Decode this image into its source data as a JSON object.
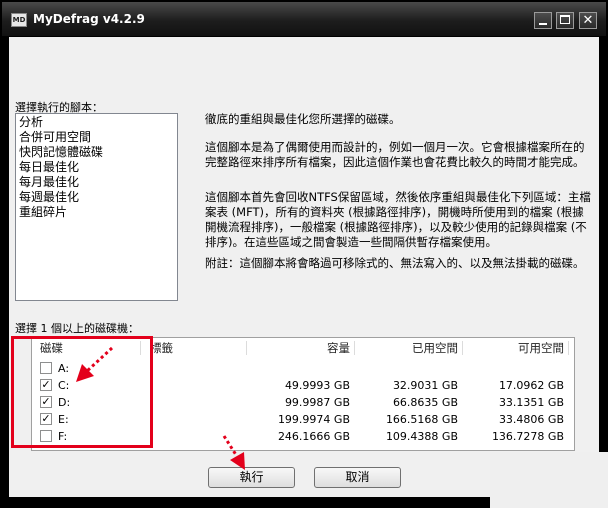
{
  "window": {
    "title": "MyDefrag v4.2.9",
    "icon_label": "MD",
    "close_glyph": "✕"
  },
  "script_section": {
    "label": "選擇執行的腳本：",
    "items": [
      "分析",
      "合併可用空間",
      "快閃記憶體磁碟",
      "每日最佳化",
      "每月最佳化",
      "每週最佳化",
      "重組碎片"
    ]
  },
  "description": {
    "heading": "徹底的重組與最佳化您所選擇的磁碟。",
    "p1": "這個腳本是為了偶爾使用而設計的，例如一個月一次。它會根據檔案所在的完整路徑來排序所有檔案，因此這個作業也會花費比較久的時間才能完成。",
    "p2": "這個腳本首先會回收NTFS保留區域，然後依序重組與最佳化下列區域：主檔案表 (MFT)，所有的資料夾 (根據路徑排序)，開機時所使用到的檔案 (根據開機流程排序)，一般檔案 (根據路徑排序)，以及較少使用的記錄與檔案 (不排序)。在這些區域之間會製造一些間隔供暫存檔案使用。",
    "p3": "附註：這個腳本將會略過可移除式的、無法寫入的、以及無法掛載的磁碟。"
  },
  "disk_section": {
    "label": "選擇 1 個以上的磁碟機：",
    "columns": [
      "磁碟",
      "標籤",
      "容量",
      "已用空間",
      "可用空間"
    ],
    "rows": [
      {
        "drive": "A:",
        "label": "",
        "capacity": "",
        "used": "",
        "free": "",
        "checked": false
      },
      {
        "drive": "C:",
        "label": "",
        "capacity": "49.9993 GB",
        "used": "32.9031 GB",
        "free": "17.0962 GB",
        "checked": true
      },
      {
        "drive": "D:",
        "label": "",
        "capacity": "99.9987 GB",
        "used": "66.8635 GB",
        "free": "33.1351 GB",
        "checked": true
      },
      {
        "drive": "E:",
        "label": "",
        "capacity": "199.9974 GB",
        "used": "166.5168 GB",
        "free": "33.4806 GB",
        "checked": true
      },
      {
        "drive": "F:",
        "label": "",
        "capacity": "246.1666 GB",
        "used": "109.4388 GB",
        "free": "136.7278 GB",
        "checked": false
      }
    ]
  },
  "buttons": {
    "run": "執行",
    "cancel": "取消"
  },
  "checkmark_glyph": "✓",
  "colors": {
    "annotation_red": "#e3001b",
    "titlebar": "#1d1d1d",
    "client_bg": "#f0f0f0"
  }
}
